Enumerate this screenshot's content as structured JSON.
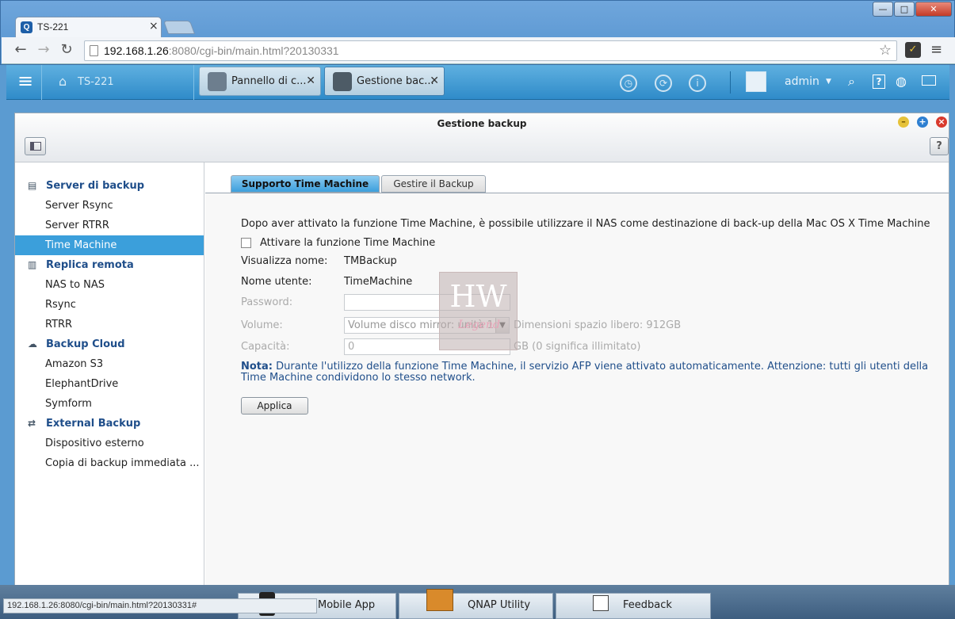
{
  "browser": {
    "tab_title": "TS-221",
    "tab_favicon": "Q",
    "tab_close": "×",
    "url_host": "192.168.1.26",
    "url_rest": ":8080/cgi-bin/main.html?20130331",
    "status_url": "192.168.1.26:8080/cgi-bin/main.html?20130331#"
  },
  "qts": {
    "home_label": "TS-221",
    "open_tabs": [
      {
        "label": "Pannello di c..."
      },
      {
        "label": "Gestione bac..."
      }
    ],
    "user": "admin",
    "user_caret": "▼"
  },
  "window": {
    "title": "Gestione backup",
    "help": "?"
  },
  "sidebar": {
    "sections": [
      {
        "label": "Server di backup",
        "items": [
          "Server Rsync",
          "Server RTRR",
          "Time Machine"
        ]
      },
      {
        "label": "Replica remota",
        "items": [
          "NAS to NAS",
          "Rsync",
          "RTRR"
        ]
      },
      {
        "label": "Backup Cloud",
        "items": [
          "Amazon S3",
          "ElephantDrive",
          "Symform"
        ]
      },
      {
        "label": "External Backup",
        "items": [
          "Dispositivo esterno",
          "Copia di backup immediata ..."
        ]
      }
    ],
    "selected": "Time Machine"
  },
  "content": {
    "tabs": [
      "Supporto Time Machine",
      "Gestire il Backup"
    ],
    "active_tab": "Supporto Time Machine",
    "intro": "Dopo aver attivato la funzione Time Machine, è possibile utilizzare il NAS come destinazione di back-up della Mac OS X Time Machine",
    "enable_label": "Attivare la funzione Time Machine",
    "enable_checked": false,
    "display_name_label": "Visualizza nome:",
    "display_name_value": "TMBackup",
    "username_label": "Nome utente:",
    "username_value": "TimeMachine",
    "password_label": "Password:",
    "password_value": "",
    "volume_label": "Volume:",
    "volume_value": "Volume disco mirror: unità  1",
    "free_space": "Dimensioni spazio libero: 912GB",
    "capacity_label": "Capacità:",
    "capacity_value": "0",
    "capacity_unit": "GB (0 significa illimitato)",
    "note_label": "Nota:",
    "note_text": " Durante l'utilizzo della funzione Time Machine, il servizio AFP viene attivato automaticamente. Attenzione: tutti gli utenti della Time Machine condividono lo stesso network.",
    "apply_button": "Applica"
  },
  "dock": {
    "items": [
      "Mobile App",
      "QNAP Utility",
      "Feedback"
    ]
  },
  "colors": {
    "accent": "#3b9fdb",
    "section_text": "#1f4e8a",
    "topbar": "#2f8bc9"
  }
}
